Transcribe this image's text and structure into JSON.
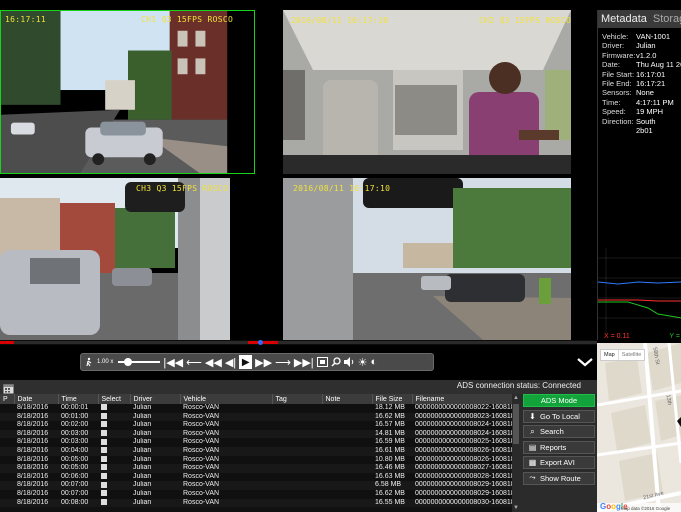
{
  "cameras": [
    {
      "id": "cam1",
      "channel_label": "CH1 Q3 15FPS ROSCO",
      "timestamp": "16:17:11",
      "selected": true
    },
    {
      "id": "cam2",
      "channel_label": "CH2 Q3 15FPS ROSCO",
      "timestamp": "2016/08/11 16:17:10"
    },
    {
      "id": "cam3",
      "channel_label": "CH3 Q3 15FPS ROSCO"
    },
    {
      "id": "cam4",
      "channel_label": "",
      "timestamp": "2016/08/11 16:17:10"
    }
  ],
  "metadata_panel": {
    "tabs": [
      "Metadata",
      "Storag"
    ],
    "rows": [
      {
        "key": "Vehicle:",
        "value": "VAN-1001"
      },
      {
        "key": "Driver:",
        "value": "Julian"
      },
      {
        "key": "Firmware:",
        "value": "v1.2.0"
      },
      {
        "key": "Date:",
        "value": "Thu Aug 11 20"
      },
      {
        "key": "File Start:",
        "value": "16:17:01"
      },
      {
        "key": "File End:",
        "value": "16:17:21"
      },
      {
        "key": "Sensors:",
        "value": "None"
      },
      {
        "key": "Time:",
        "value": "4:17:11 PM"
      },
      {
        "key": "Speed:",
        "value": "19 MPH"
      },
      {
        "key": "Direction:",
        "value": "South"
      },
      {
        "key": "",
        "value": "2b01"
      }
    ],
    "accel_x_label": "X = 0.11",
    "accel_y_label": "Y ="
  },
  "controls": {
    "speed": "1.00 x",
    "icons": [
      "speed-icon",
      "skip-start-icon",
      "rewind-10-icon",
      "rewind-icon",
      "step-back-icon",
      "play-icon",
      "fast-forward-icon",
      "forward-10-icon",
      "skip-end-icon",
      "snapshot-icon",
      "zoom-icon",
      "volume-icon",
      "brightness-icon",
      "contrast-icon",
      "collapse-chevron-icon"
    ]
  },
  "list": {
    "ads_status": "ADS connection status: Connected",
    "columns": [
      "P",
      "Date",
      "Time",
      "Select",
      "Driver",
      "Vehicle",
      "Tag",
      "Note",
      "File Size",
      "Filename"
    ],
    "rows": [
      {
        "date": "8/18/2016",
        "time": "00:00:01",
        "driver": "Julian",
        "vehicle": "Rosco-VAN",
        "size": "18.12 MB",
        "filename": "0000000000000008022-160818-0"
      },
      {
        "date": "8/18/2016",
        "time": "00:01:00",
        "driver": "Julian",
        "vehicle": "Rosco-VAN",
        "size": "16.62 MB",
        "filename": "0000000000000008023-160818-0"
      },
      {
        "date": "8/18/2016",
        "time": "00:02:00",
        "driver": "Julian",
        "vehicle": "Rosco-VAN",
        "size": "16.57 MB",
        "filename": "0000000000000008024-160818-0"
      },
      {
        "date": "8/18/2016",
        "time": "00:03:00",
        "driver": "Julian",
        "vehicle": "Rosco-VAN",
        "size": "14.81 MB",
        "filename": "0000000000000008024-160818-0"
      },
      {
        "date": "8/18/2016",
        "time": "00:03:00",
        "driver": "Julian",
        "vehicle": "Rosco-VAN",
        "size": "16.59 MB",
        "filename": "0000000000000008025-160818-0"
      },
      {
        "date": "8/18/2016",
        "time": "00:04:00",
        "driver": "Julian",
        "vehicle": "Rosco-VAN",
        "size": "16.61 MB",
        "filename": "0000000000000008026-160818-0"
      },
      {
        "date": "8/18/2016",
        "time": "00:05:00",
        "driver": "Julian",
        "vehicle": "Rosco-VAN",
        "size": "10.80 MB",
        "filename": "0000000000000008026-160818-0"
      },
      {
        "date": "8/18/2016",
        "time": "00:05:00",
        "driver": "Julian",
        "vehicle": "Rosco-VAN",
        "size": "16.46 MB",
        "filename": "0000000000000008027-160818-0"
      },
      {
        "date": "8/18/2016",
        "time": "00:06:00",
        "driver": "Julian",
        "vehicle": "Rosco-VAN",
        "size": "16.63 MB",
        "filename": "0000000000000008028-160818-0"
      },
      {
        "date": "8/18/2016",
        "time": "00:07:00",
        "driver": "Julian",
        "vehicle": "Rosco-VAN",
        "size": "6.58 MB",
        "filename": "0000000000000008029-160818-0"
      },
      {
        "date": "8/18/2016",
        "time": "00:07:00",
        "driver": "Julian",
        "vehicle": "Rosco-VAN",
        "size": "16.62 MB",
        "filename": "0000000000000008029-160818-0"
      },
      {
        "date": "8/18/2016",
        "time": "00:08:00",
        "driver": "Julian",
        "vehicle": "Rosco-VAN",
        "size": "16.55 MB",
        "filename": "0000000000000008030-160818-0"
      }
    ]
  },
  "side_buttons": [
    {
      "label": "ADS Mode",
      "icon": "",
      "active": true
    },
    {
      "label": "Go To Local",
      "icon": "download-icon"
    },
    {
      "label": "Search",
      "icon": "search-icon"
    },
    {
      "label": "Reports",
      "icon": "reports-icon"
    },
    {
      "label": "Export AVI",
      "icon": "export-icon"
    },
    {
      "label": "Show Route",
      "icon": "route-icon"
    }
  ],
  "map": {
    "tabs": [
      "Map",
      "Satellite"
    ],
    "streets": [
      "58th St",
      "13th",
      "21st Ave"
    ],
    "logo": "Google",
    "attribution": "Map data ©2016 Google"
  },
  "colors": {
    "overlay_text": "#f2e23a",
    "selected_border": "#18d418",
    "timeline_red": "#d80000",
    "ads_green": "#12a33a"
  }
}
